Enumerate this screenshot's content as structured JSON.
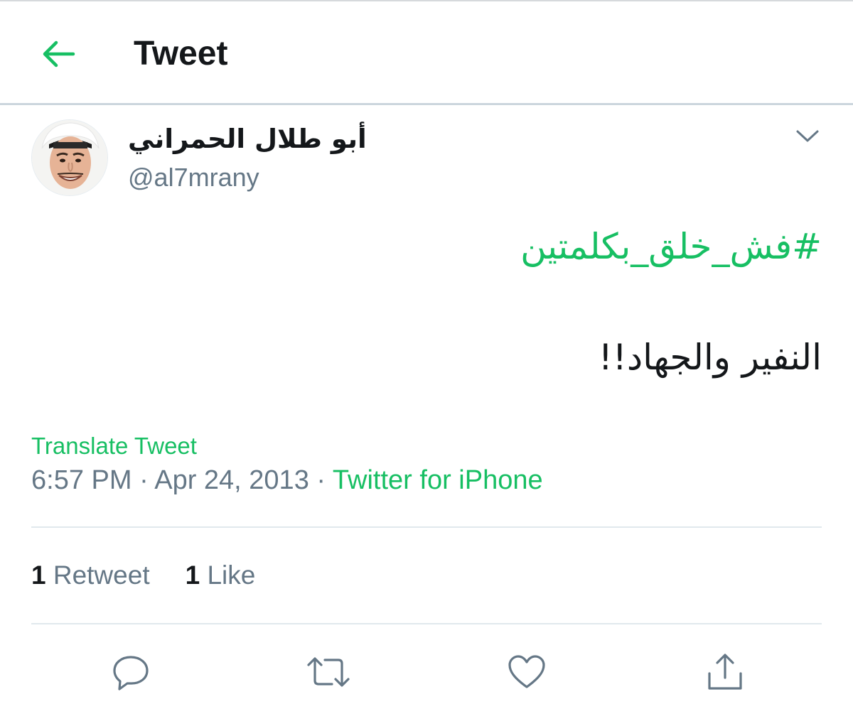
{
  "header": {
    "title": "Tweet",
    "back_icon": "arrow-left-icon"
  },
  "colors": {
    "accent": "#17bf63",
    "text_primary": "#14171a",
    "text_secondary": "#657786",
    "divider": "#e1e8ed"
  },
  "author": {
    "display_name": "أبو طلال الحمراني",
    "handle": "@al7mrany",
    "avatar_icon": "avatar-photo",
    "menu_icon": "chevron-down-icon"
  },
  "tweet": {
    "hashtag": "#فش_خلق_بكلمتين",
    "text": "النفير والجهاد!!",
    "translate_label": "Translate Tweet",
    "time": "6:57 PM",
    "separator": " · ",
    "date": "Apr 24, 2013",
    "source": "Twitter for iPhone"
  },
  "stats": {
    "retweets_count": "1",
    "retweets_label": "Retweet",
    "likes_count": "1",
    "likes_label": "Like"
  },
  "actions": [
    {
      "name": "reply",
      "icon": "reply-icon"
    },
    {
      "name": "retweet",
      "icon": "retweet-icon"
    },
    {
      "name": "like",
      "icon": "heart-icon"
    },
    {
      "name": "share",
      "icon": "share-icon"
    }
  ]
}
